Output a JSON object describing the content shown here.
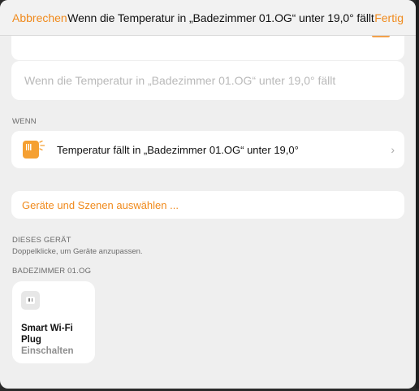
{
  "header": {
    "cancel_label": "Abbrechen",
    "title": "Wenn die Temperatur in „Badezimmer 01.OG“ unter 19,0° fällt",
    "done_label": "Fertig"
  },
  "name_field": {
    "placeholder": "Wenn die Temperatur in „Badezimmer 01.OG“ unter 19,0° fällt",
    "value": ""
  },
  "when_section": {
    "label": "WENN",
    "trigger_text": "Temperatur fällt in „Badezimmer 01.OG“ unter 19,0°",
    "icon": "thermometer-sensor-icon",
    "chevron": "›"
  },
  "select_button_label": "Geräte und Szenen auswählen ...",
  "device_section": {
    "label": "DIESES GERÄT",
    "hint": "Doppelklicke, um Geräte anzupassen."
  },
  "room_section": {
    "label": "BADEZIMMER 01.OG",
    "devices": [
      {
        "name": "Smart Wi-Fi Plug",
        "state": "Einschalten",
        "icon": "outlet-plug-icon"
      }
    ]
  },
  "colors": {
    "accent": "#f08a1c",
    "sensor_icon": "#f5a032",
    "background": "#efefef",
    "card": "#ffffff"
  }
}
